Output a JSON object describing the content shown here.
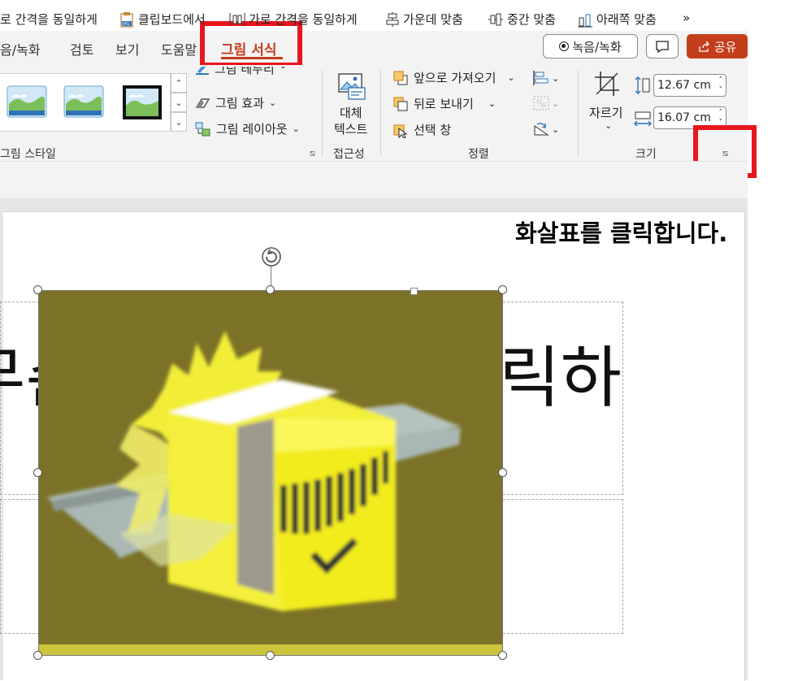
{
  "tabs": {
    "partial_record": "음/녹화",
    "review": "검토",
    "view": "보기",
    "help": "도움말",
    "active": "그림 서식"
  },
  "header_buttons": {
    "record": "녹음/녹화",
    "share": "공유"
  },
  "ribbon": {
    "picture_border": "그림 테두리",
    "picture_effects": "그림 효과",
    "picture_layout": "그림 레이아웃",
    "alt_text_line1": "대체",
    "alt_text_line2": "텍스트",
    "bring_forward": "앞으로 가져오기",
    "send_backward": "뒤로 보내기",
    "selection_pane": "선택 창",
    "crop": "자르기",
    "height_value": "12.67 cm",
    "width_value": "16.07 cm",
    "groups": {
      "picture_styles": "그림 스타일",
      "accessibility": "접근성",
      "arrange": "정렬",
      "size": "크기"
    }
  },
  "qat": {
    "distribute_vertically": "로 간격을 동일하게",
    "paste_from_clipboard": "클립보드에서",
    "distribute_horizontally": "가로 간격을 동일하게",
    "align_center": "가운데 맞춤",
    "align_middle": "중간 맞춤",
    "align_bottom": "아래쪽 맞춤",
    "more": "»"
  },
  "slide": {
    "title_left": "무슨",
    "title_right": "릭하"
  },
  "annotation": {
    "instruction": "화살표를 클릭합니다."
  },
  "icons": [
    "record-dot-icon",
    "comment-icon",
    "share-icon",
    "picture-border-icon",
    "picture-effects-icon",
    "picture-layout-icon",
    "alt-text-icon",
    "bring-forward-icon",
    "send-backward-icon",
    "selection-pane-icon",
    "align-icon",
    "group-icon",
    "rotate-icon",
    "crop-icon",
    "height-icon",
    "width-icon",
    "dialog-launcher-icon",
    "clipboard-icon",
    "rotate-handle-icon"
  ],
  "colors": {
    "accent": "#c43e1c",
    "highlight": "#e8161e",
    "picture_bg": "#7b7228",
    "picture_yellow": "#f4ef3a"
  }
}
